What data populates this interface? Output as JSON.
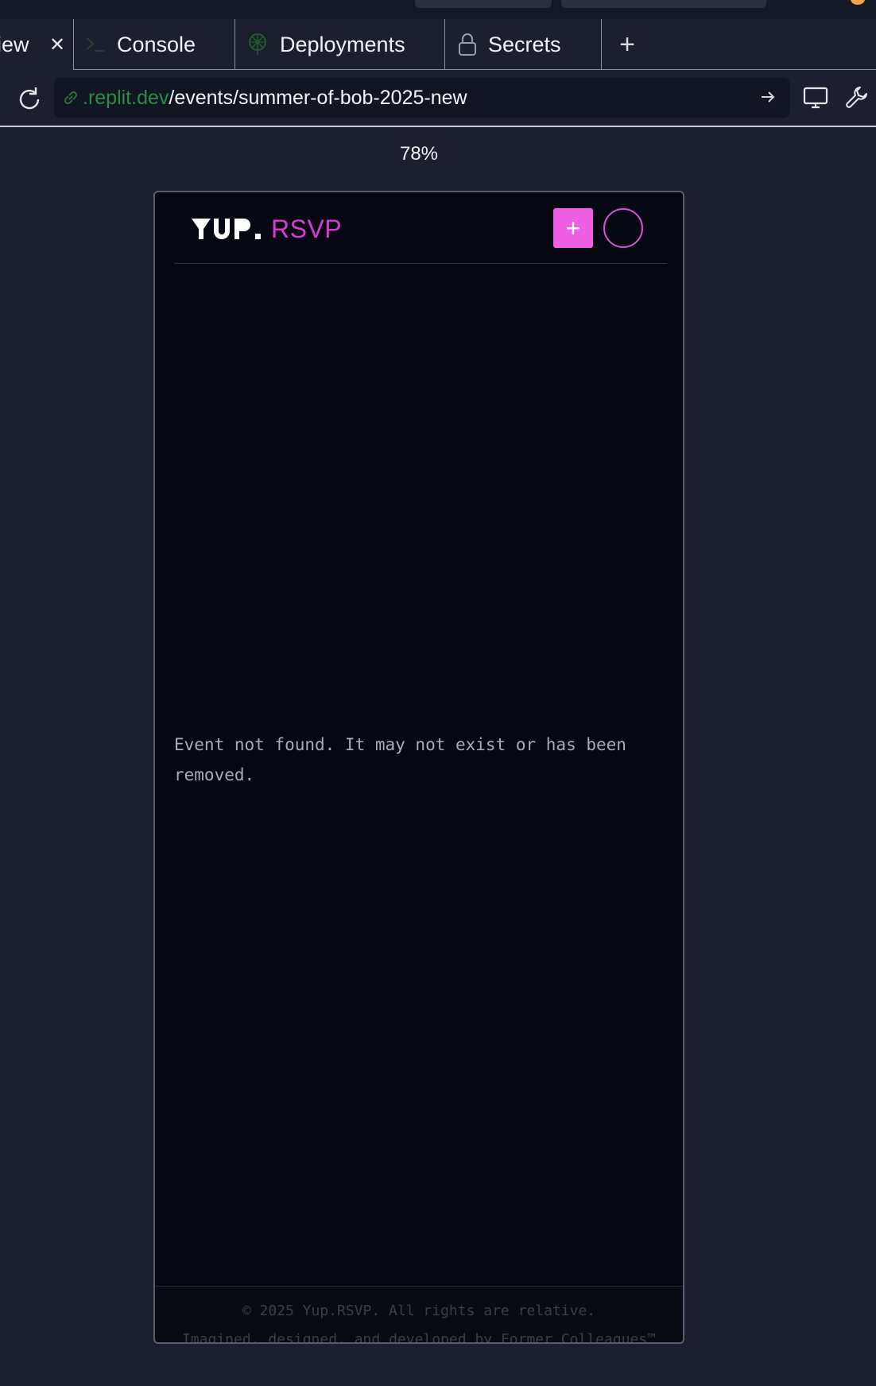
{
  "tabs": {
    "preview_label": "iew",
    "console_label": "Console",
    "deployments_label": "Deployments",
    "secrets_label": "Secrets",
    "new_tab_label": "+"
  },
  "address": {
    "host": ".replit.dev",
    "path": "/events/summer-of-bob-2025-new"
  },
  "zoom_label": "78%",
  "app": {
    "logo_text": "YUP.",
    "logo_suffix": "RSVP",
    "add_label": "+",
    "message": "Event not found. It may not exist or has been removed.",
    "footer_copy": "© 2025 Yup.RSVP. All rights are relative.",
    "footer_credit": "Imagined, designed, and developed by Former Colleagues™"
  },
  "colors": {
    "accent_pink": "#ee5fe3",
    "rsvp_magenta": "#d63cd0",
    "url_host_green": "#2e8b45",
    "frame_bg": "#050712",
    "chrome_bg": "#1c1f2e"
  }
}
